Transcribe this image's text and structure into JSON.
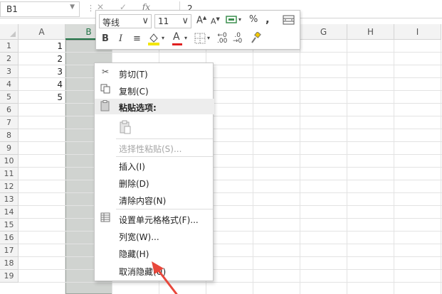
{
  "name_box": {
    "value": "B1"
  },
  "formula_bar": {
    "cancel_icon": "cancel-icon",
    "confirm_icon": "confirm-icon",
    "function_label": "fx",
    "value": "2"
  },
  "columns": [
    "A",
    "B",
    "C",
    "D",
    "E",
    "F",
    "G",
    "H",
    "I"
  ],
  "selected_column": "B",
  "rows": [
    "1",
    "2",
    "3",
    "4",
    "5",
    "6",
    "7",
    "8",
    "9",
    "10",
    "11",
    "12",
    "13",
    "14",
    "15",
    "16",
    "17",
    "18",
    "19"
  ],
  "cells_a": [
    "1",
    "2",
    "3",
    "4",
    "5"
  ],
  "mini_toolbar": {
    "font_name": "等线",
    "font_size": "11",
    "grow_font": "A",
    "shrink_font": "A",
    "percent": "%",
    "comma": ",",
    "bold": "B",
    "italic": "I",
    "font_color": "A",
    "inc_decimal": ".00",
    "dec_decimal": ".0"
  },
  "context_menu": {
    "cut": "剪切(T)",
    "copy": "复制(C)",
    "paste_options": "粘贴选项:",
    "paste_special": "选择性粘贴(S)...",
    "insert": "插入(I)",
    "delete": "删除(D)",
    "clear_contents": "清除内容(N)",
    "format_cells": "设置单元格格式(F)...",
    "column_width": "列宽(W)...",
    "hide": "隐藏(H)",
    "unhide": "取消隐藏(U)"
  },
  "colors": {
    "accent": "#217346",
    "arrow": "#e8473b",
    "selection": "#d0d3d0"
  }
}
